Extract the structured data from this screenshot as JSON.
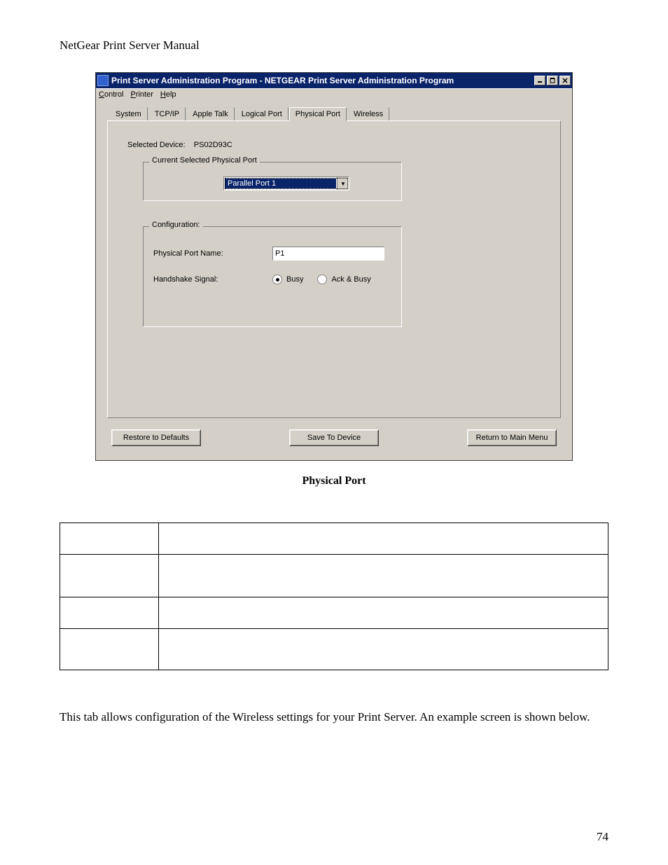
{
  "doc": {
    "header": "NetGear Print Server Manual",
    "figure_caption": "Physical Port",
    "body_para": "This tab allows configuration of the Wireless settings for your Print Server. An example screen is shown below.",
    "page_no": "74"
  },
  "window": {
    "title": "Print Server Administration Program - NETGEAR Print Server Administration Program",
    "menubar": {
      "control": {
        "under": "C",
        "rest": "ontrol"
      },
      "printer": {
        "under": "P",
        "rest": "rinter"
      },
      "help": {
        "under": "H",
        "rest": "elp"
      }
    },
    "tabs": {
      "system": "System",
      "tcpip": "TCP/IP",
      "appletalk": "Apple Talk",
      "logical": "Logical Port",
      "physical": "Physical Port",
      "wireless": "Wireless"
    },
    "selected_device_label": "Selected Device:",
    "selected_device_value": "PS02D93C",
    "fieldset_port": {
      "legend": "Current Selected Physical Port",
      "combo_value": "Parallel Port 1"
    },
    "fieldset_config": {
      "legend": "Configuration:",
      "row1_label": "Physical Port Name:",
      "row1_value": "P1",
      "row2_label": "Handshake Signal:",
      "radio_busy": "Busy",
      "radio_ack": "Ack & Busy"
    },
    "buttons": {
      "restore": "Restore to Defaults",
      "save": "Save To Device",
      "return": "Return to Main Menu"
    }
  }
}
